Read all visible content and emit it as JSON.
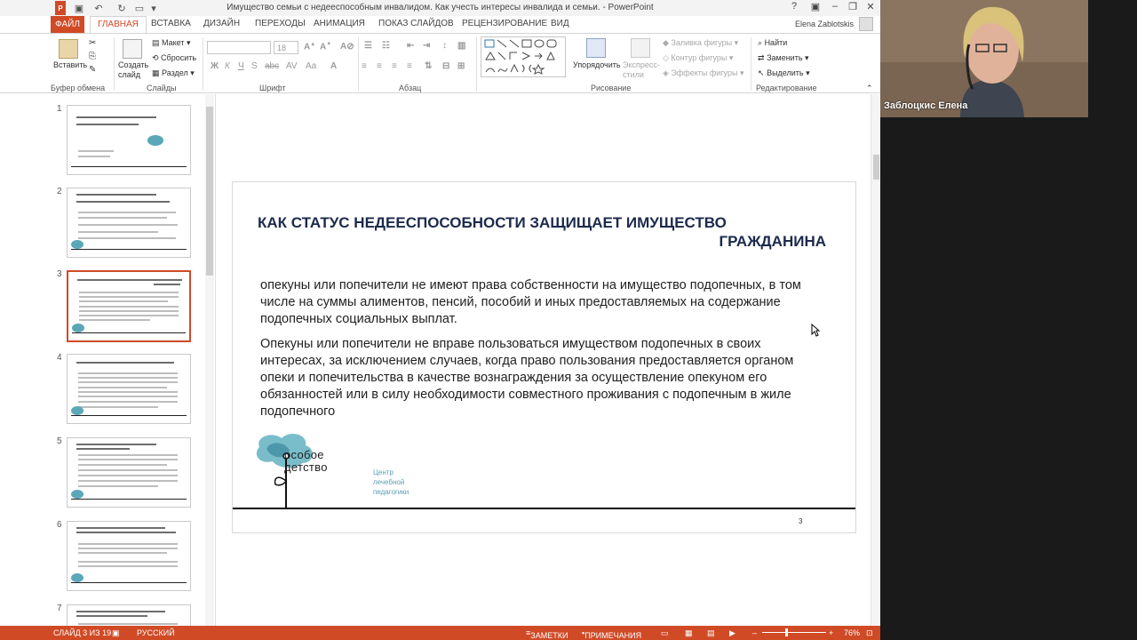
{
  "window": {
    "title": "Имущество семьи с недееспособным инвалидом. Как учесть интересы инвалида и семьи. - PowerPoint",
    "user_name": "Elena Zablotskis",
    "help_glyph": "?",
    "minimize_glyph": "–",
    "restore_glyph": "❐",
    "close_glyph": "✕"
  },
  "tabs": [
    "ФАЙЛ",
    "ГЛАВНАЯ",
    "ВСТАВКА",
    "ДИЗАЙН",
    "ПЕРЕХОДЫ",
    "АНИМАЦИЯ",
    "ПОКАЗ СЛАЙДОВ",
    "РЕЦЕНЗИРОВАНИЕ",
    "ВИД"
  ],
  "ribbon": {
    "clipboard": {
      "paste": "Вставить",
      "group": "Буфер обмена"
    },
    "slides": {
      "new_slide": "Создать слайд",
      "layout": "Макет",
      "reset": "Сбросить",
      "section": "Раздел",
      "group": "Слайды"
    },
    "font": {
      "group": "Шрифт",
      "size": "18"
    },
    "paragraph": {
      "group": "Абзац"
    },
    "drawing": {
      "arrange": "Упорядочить",
      "styles": "Экспресс-стили",
      "fill": "Заливка фигуры",
      "outline": "Контур фигуры",
      "effects": "Эффекты фигуры",
      "group": "Рисование"
    },
    "editing": {
      "find": "Найти",
      "replace": "Заменить",
      "select": "Выделить",
      "group": "Редактирование"
    }
  },
  "thumbnails": [
    {
      "num": "1",
      "selected": false
    },
    {
      "num": "2",
      "selected": false
    },
    {
      "num": "3",
      "selected": true
    },
    {
      "num": "4",
      "selected": false
    },
    {
      "num": "5",
      "selected": false
    },
    {
      "num": "6",
      "selected": false
    },
    {
      "num": "7",
      "selected": false
    }
  ],
  "slide": {
    "title_line1": "КАК СТАТУС НЕДЕЕСПОСОБНОСТИ ЗАЩИЩАЕТ ИМУЩЕСТВО",
    "title_line2": "ГРАЖДАНИНА",
    "para1": "опекуны или попечители не имеют права собственности на имущество подопечных, в том числе на суммы алиментов, пенсий, пособий и иных предоставляемых на содержание подопечных социальных выплат.",
    "para2": "Опекуны или попечители не вправе пользоваться имуществом подопечных в своих интересах, за исключением случаев,  когда право пользования предоставляется органом опеки и попечительства в качестве вознаграждения за осуществление опекуном его обязанностей или в силу необходимости совместного проживания с подопечным в жиле подопечного",
    "logo_line1": "особое",
    "logo_line2": "детство",
    "logo_sub": "Центр\nлечебной\nпедагогики",
    "number": "3"
  },
  "status": {
    "slide_info": "СЛАЙД 3 ИЗ 19",
    "language": "РУССКИЙ",
    "notes": "ЗАМЕТКИ",
    "comments": "ПРИМЕЧАНИЯ",
    "zoom": "76%"
  },
  "webcam": {
    "name": "Заблоцкис Елена"
  },
  "colors": {
    "accent": "#d04a26",
    "title": "#1b2a4c",
    "logo": "#5aa7b8"
  }
}
